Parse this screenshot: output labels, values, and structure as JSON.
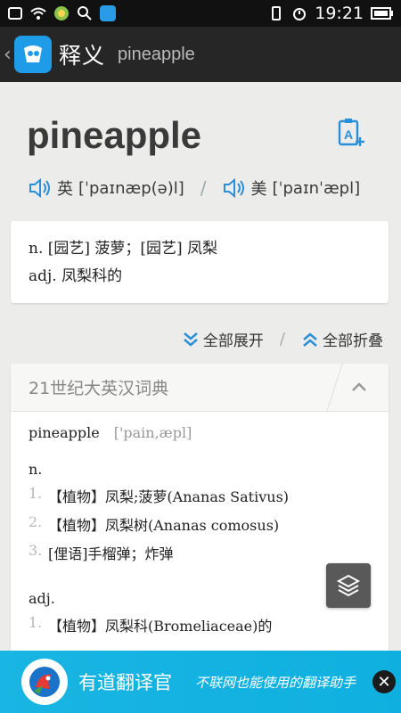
{
  "status_bar": {
    "time": "19:21"
  },
  "app_bar": {
    "title": "释义",
    "query": "pineapple"
  },
  "entry": {
    "word": "pineapple",
    "phonetic_uk_label": "英",
    "phonetic_uk": "[ˈpaɪnæp(ə)l]",
    "separator": "/",
    "phonetic_us_label": "美",
    "phonetic_us": "[ˈpaɪnˈæpl]"
  },
  "definitions": [
    "n. [园艺] 菠萝；[园艺] 凤梨",
    "adj. 凤梨科的"
  ],
  "toggles": {
    "expand_all": "全部展开",
    "separator": "/",
    "collapse_all": "全部折叠"
  },
  "dictionary": {
    "title": "21世纪大英汉词典",
    "headword": "pineapple",
    "headword_phonetic": "['pain,æpl]",
    "noun_label": "n.",
    "noun_items": [
      {
        "num": "1.",
        "text": "【植物】凤梨;菠萝(Ananas Sativus)"
      },
      {
        "num": "2.",
        "text": "【植物】凤梨树(Ananas comosus)"
      },
      {
        "num": "3.",
        "text": "[俚语]手榴弹；炸弹"
      }
    ],
    "adj_label": "adj.",
    "adj_items": [
      {
        "num": "1.",
        "text": "【植物】凤梨科(Bromeliaceae)的"
      }
    ]
  },
  "banner": {
    "title": "有道翻译官",
    "slogan": "不联网也能使用的翻译助手",
    "close": "✕"
  },
  "colors": {
    "accent": "#1f9ce8",
    "banner": "#19b5e3",
    "appbar": "#262626"
  }
}
